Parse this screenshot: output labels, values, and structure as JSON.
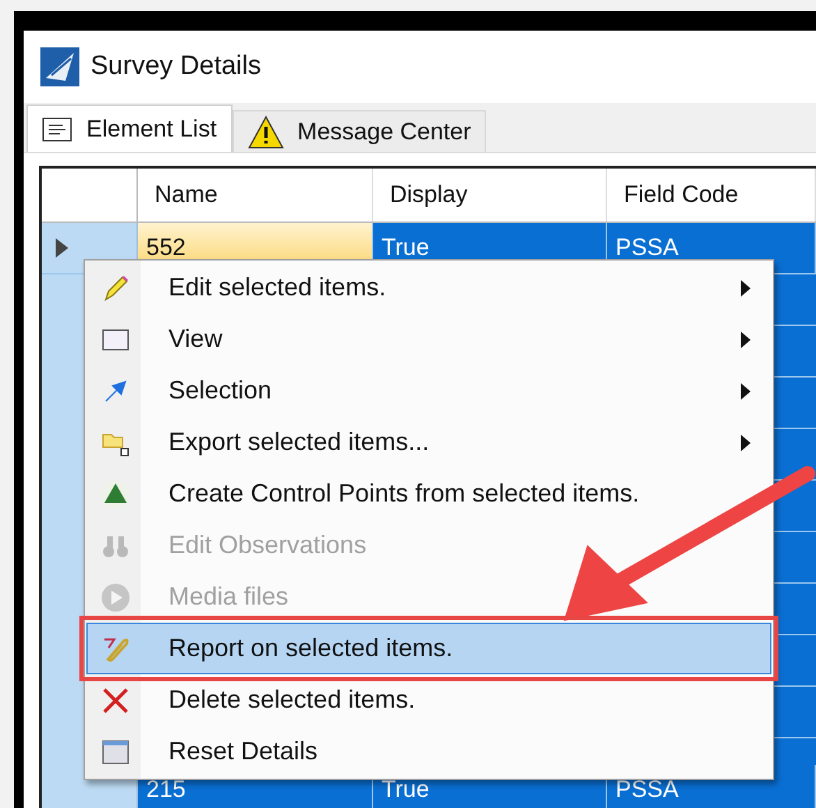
{
  "window": {
    "title": "Survey Details"
  },
  "tabs": [
    {
      "label": "Element List",
      "selected": true
    },
    {
      "label": "Message Center",
      "selected": false
    }
  ],
  "table": {
    "columns": [
      "Name",
      "Display",
      "Field Code"
    ],
    "rows": [
      {
        "cells": [
          "552",
          "True",
          "PSSA"
        ],
        "selected": true,
        "current": true
      },
      {
        "cells": [
          "215",
          "True",
          "PSSA"
        ],
        "selected": true,
        "current": false
      }
    ]
  },
  "context_menu": {
    "items": [
      {
        "label": "Edit selected items.",
        "submenu": true,
        "disabled": false,
        "selected": false
      },
      {
        "label": "View",
        "submenu": true,
        "disabled": false,
        "selected": false
      },
      {
        "label": "Selection",
        "submenu": true,
        "disabled": false,
        "selected": false
      },
      {
        "label": "Export selected items...",
        "submenu": true,
        "disabled": false,
        "selected": false
      },
      {
        "label": "Create Control Points from selected items.",
        "submenu": false,
        "disabled": false,
        "selected": false
      },
      {
        "label": "Edit Observations",
        "submenu": false,
        "disabled": true,
        "selected": false
      },
      {
        "label": "Media files",
        "submenu": false,
        "disabled": true,
        "selected": false
      },
      {
        "label": "Report on selected items.",
        "submenu": false,
        "disabled": false,
        "selected": true
      },
      {
        "label": "Delete selected items.",
        "submenu": false,
        "disabled": false,
        "selected": false
      },
      {
        "label": "Reset Details",
        "submenu": false,
        "disabled": false,
        "selected": false
      }
    ]
  }
}
